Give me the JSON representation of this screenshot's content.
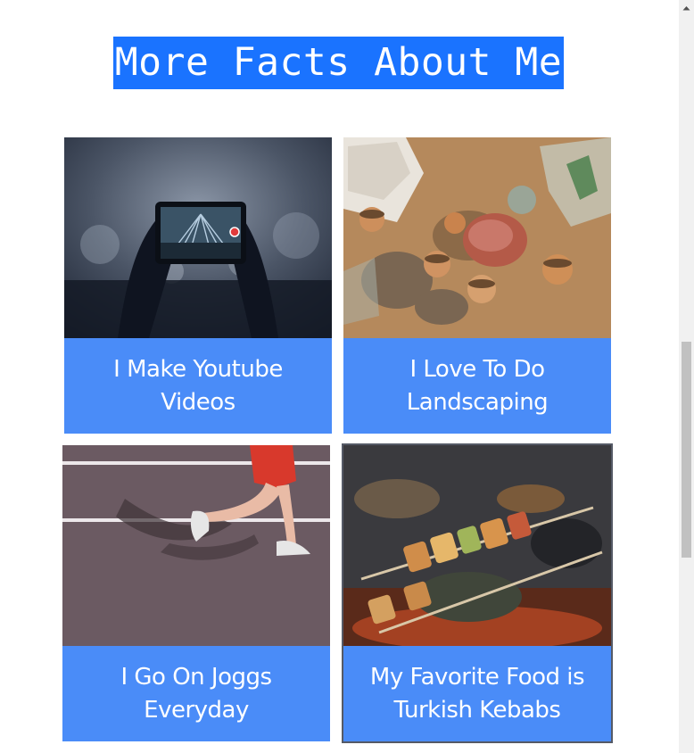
{
  "section": {
    "title": "More Facts About Me"
  },
  "cards": [
    {
      "caption": "I Make Youtube Videos",
      "image": "phone-recording-concert-photo"
    },
    {
      "caption": "I Love To Do Landscaping",
      "image": "soil-and-plant-pots-photo"
    },
    {
      "caption": "I Go On Joggs Everyday",
      "image": "runner-legs-on-track-photo"
    },
    {
      "caption": "My Favorite Food is Turkish Kebabs",
      "image": "grilled-kebabs-photo"
    }
  ],
  "colors": {
    "heading_bg": "#1a73ff",
    "card_bg": "#4a8cf8",
    "text": "#ffffff"
  },
  "scrollbar": {
    "up_icon": "chevron-up-icon"
  }
}
